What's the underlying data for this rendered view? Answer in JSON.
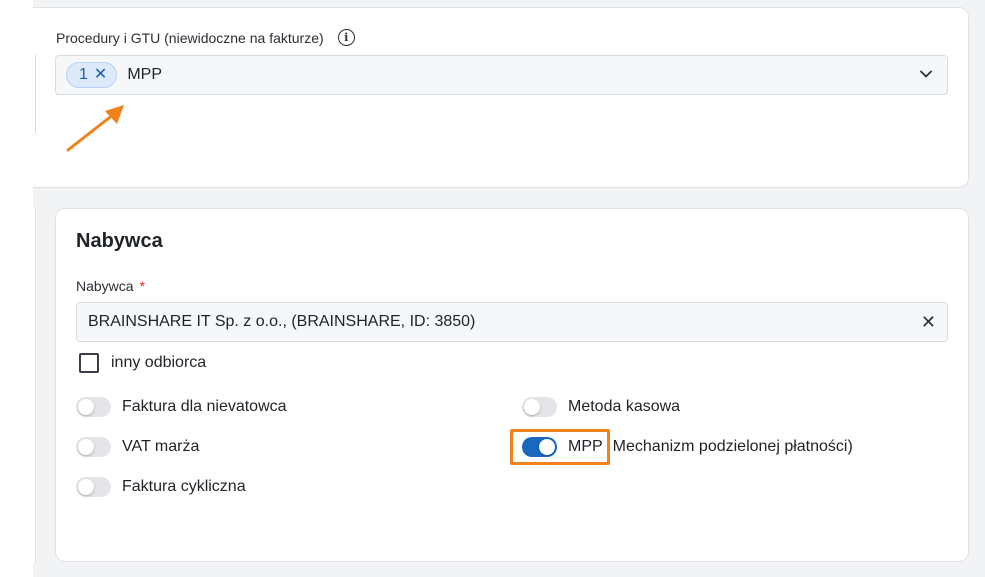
{
  "gtu": {
    "label": "Procedury i GTU (niewidoczne na fakturze)",
    "info_glyph": "i",
    "chip_count": "1",
    "chip_remove_glyph": "✕",
    "selected": "MPP"
  },
  "buyer_section": {
    "title": "Nabywca",
    "buyer_label": "Nabywca",
    "required_mark": "*",
    "buyer_value": "BRAINSHARE IT Sp. z o.o., (BRAINSHARE, ID: 3850)",
    "clear_glyph": "✕",
    "other_recipient_label": "inny odbiorca"
  },
  "toggles": [
    {
      "label": "Faktura dla nievatowca",
      "on": false
    },
    {
      "label": "VAT marża",
      "on": false
    },
    {
      "label": "Faktura cykliczna",
      "on": false
    },
    {
      "label": "Metoda kasowa",
      "on": false
    },
    {
      "label": "MPP",
      "on": true
    },
    {
      "label": "Mechanizm podzielonej płatności)",
      "on": false
    }
  ],
  "colors": {
    "accent": "#1867c0",
    "highlight": "#f0821e",
    "chip_bg": "#dbe9fb"
  }
}
